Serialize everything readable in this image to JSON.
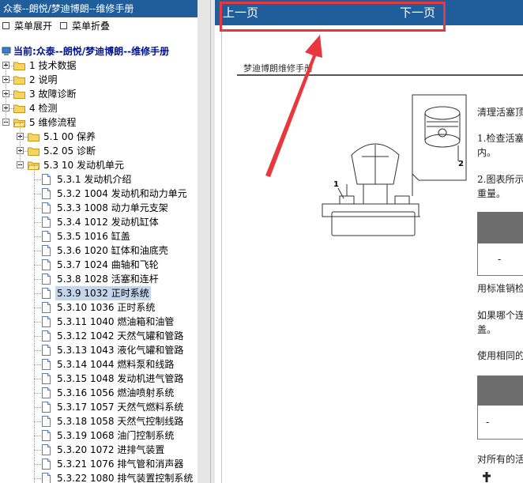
{
  "window": {
    "title": "众泰--朗悦/梦迪博朗--维修手册"
  },
  "menu": {
    "expand_label": "菜单展开",
    "collapse_label": "菜单折叠"
  },
  "current": {
    "label": "当前:众泰--朗悦/梦迪博朗--维修手册"
  },
  "tree": {
    "top": [
      {
        "label": "1 技术数据"
      },
      {
        "label": "2 说明"
      },
      {
        "label": "3 故障诊断"
      },
      {
        "label": "4 检测"
      },
      {
        "label": "5 维修流程"
      }
    ],
    "sub": [
      {
        "label": "5.1 00 保养"
      },
      {
        "label": "5.2 05 诊断"
      },
      {
        "label": "5.3 10 发动机单元"
      }
    ],
    "leaves": [
      {
        "label": "5.3.1 发动机介绍"
      },
      {
        "label": "5.3.2 1004 发动机和动力单元"
      },
      {
        "label": "5.3.3 1008 动力单元支架"
      },
      {
        "label": "5.3.4 1012 发动机缸体"
      },
      {
        "label": "5.3.5 1016 缸盖"
      },
      {
        "label": "5.3.6 1020 缸体和油底壳"
      },
      {
        "label": "5.3.7 1024 曲轴和飞轮"
      },
      {
        "label": "5.3.8 1028 活塞和连杆"
      },
      {
        "label": "5.3.9 1032 正时系统",
        "selected": true
      },
      {
        "label": "5.3.10 1036 正时系统"
      },
      {
        "label": "5.3.11 1040 燃油箱和油管"
      },
      {
        "label": "5.3.12 1042 天然气罐和管路"
      },
      {
        "label": "5.3.13 1043 液化气罐和管路"
      },
      {
        "label": "5.3.14 1044 燃料泵和线路"
      },
      {
        "label": "5.3.15 1048 发动机进气管路"
      },
      {
        "label": "5.3.16 1056 燃油喷射系统"
      },
      {
        "label": "5.3.17 1057 天然气燃料系统"
      },
      {
        "label": "5.3.18 1058 天然气控制线路"
      },
      {
        "label": "5.3.19 1068 油门控制系统"
      },
      {
        "label": "5.3.20 1072 进排气装置"
      },
      {
        "label": "5.3.21 1076 排气管和消声器"
      },
      {
        "label": "5.3.22 1080 排气装置控制系统"
      }
    ]
  },
  "viewer": {
    "prev_label": "上一页",
    "next_label": "下一页",
    "page_header": "梦迪博朗维修手册",
    "text_lines": [
      "清理活塞顶",
      "1.检查活塞",
      "内。",
      "2.图表所示",
      "重量。",
      "用标准销检",
      "如果哪个连",
      "盖。",
      "使用相同的",
      "对所有的活"
    ],
    "figure_callouts": [
      "1",
      "2"
    ],
    "table_dash": "-"
  },
  "colors": {
    "title_bar": "#1f5d9b",
    "selection": "#c3d6ec",
    "annotation_red": "#e8383d",
    "current_text": "#00128c"
  }
}
